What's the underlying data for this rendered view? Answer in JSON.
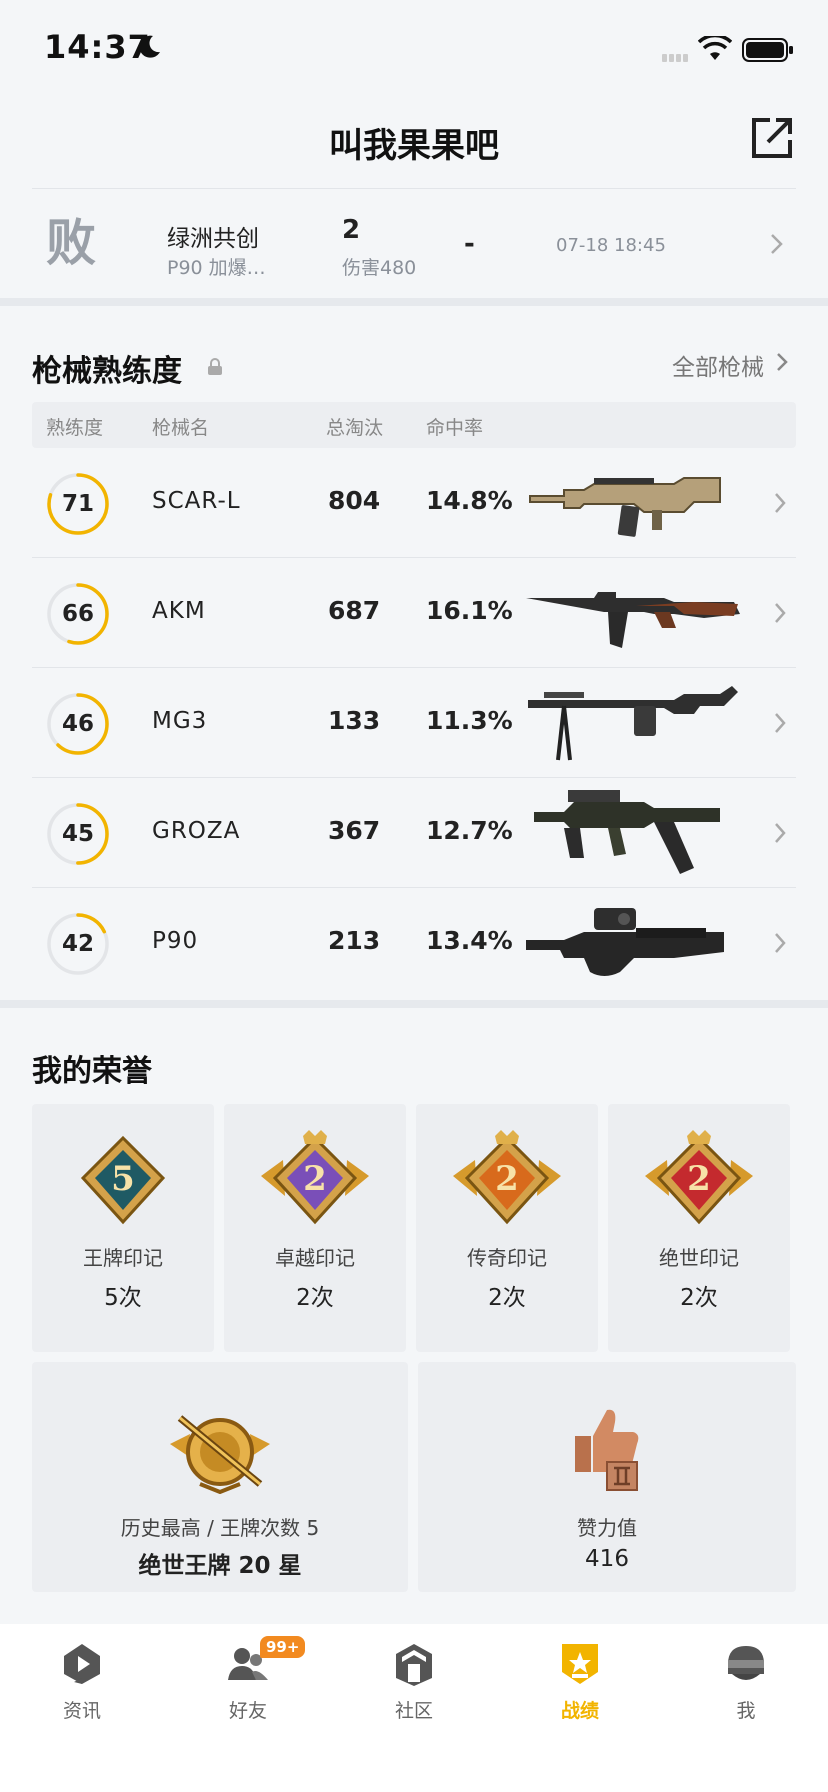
{
  "status_bar": {
    "time": "14:37"
  },
  "header": {
    "title": "叫我果果吧"
  },
  "recent_match": {
    "result": "败",
    "map": "绿洲共创",
    "desc": "P90 加爆…",
    "kills": "2",
    "damage": "伤害480",
    "dash": "-",
    "time": "07-18 18:45"
  },
  "weapons": {
    "title": "枪械熟练度",
    "all_link": "全部枪械",
    "columns": {
      "proficiency": "熟练度",
      "name": "枪械名",
      "kills": "总淘汰",
      "hit_rate": "命中率"
    },
    "rows": [
      {
        "level": "71",
        "progress": 0.8,
        "name": "SCAR-L",
        "kills": "804",
        "hit_rate": "14.8%",
        "gun": "scar-l"
      },
      {
        "level": "66",
        "progress": 0.55,
        "name": "AKM",
        "kills": "687",
        "hit_rate": "16.1%",
        "gun": "akm"
      },
      {
        "level": "46",
        "progress": 0.62,
        "name": "MG3",
        "kills": "133",
        "hit_rate": "11.3%",
        "gun": "mg3"
      },
      {
        "level": "45",
        "progress": 0.5,
        "name": "GROZA",
        "kills": "367",
        "hit_rate": "12.7%",
        "gun": "groza"
      },
      {
        "level": "42",
        "progress": 0.18,
        "name": "P90",
        "kills": "213",
        "hit_rate": "13.4%",
        "gun": "p90"
      }
    ]
  },
  "honors": {
    "title": "我的荣誉",
    "marks": [
      {
        "label": "王牌印记",
        "value": "5次",
        "badge_num": "5",
        "color": "#1f5a64"
      },
      {
        "label": "卓越印记",
        "value": "2次",
        "badge_num": "2",
        "color": "#7a4fb8"
      },
      {
        "label": "传奇印记",
        "value": "2次",
        "badge_num": "2",
        "color": "#d86a1c"
      },
      {
        "label": "绝世印记",
        "value": "2次",
        "badge_num": "2",
        "color": "#c42a2e"
      }
    ],
    "history": {
      "label": "历史最高 / 王牌次数 5",
      "value": "绝世王牌 20 星"
    },
    "likes": {
      "label": "赞力值",
      "value": "416"
    }
  },
  "tabbar": {
    "tabs": [
      {
        "label": "资讯",
        "icon": "news-icon"
      },
      {
        "label": "好友",
        "icon": "friends-icon",
        "badge": "99+"
      },
      {
        "label": "社区",
        "icon": "community-icon"
      },
      {
        "label": "战绩",
        "icon": "record-icon",
        "active": true
      },
      {
        "label": "我",
        "icon": "profile-icon"
      }
    ]
  },
  "colors": {
    "accent": "#f2b400",
    "ring_track": "#e3e5e8"
  }
}
